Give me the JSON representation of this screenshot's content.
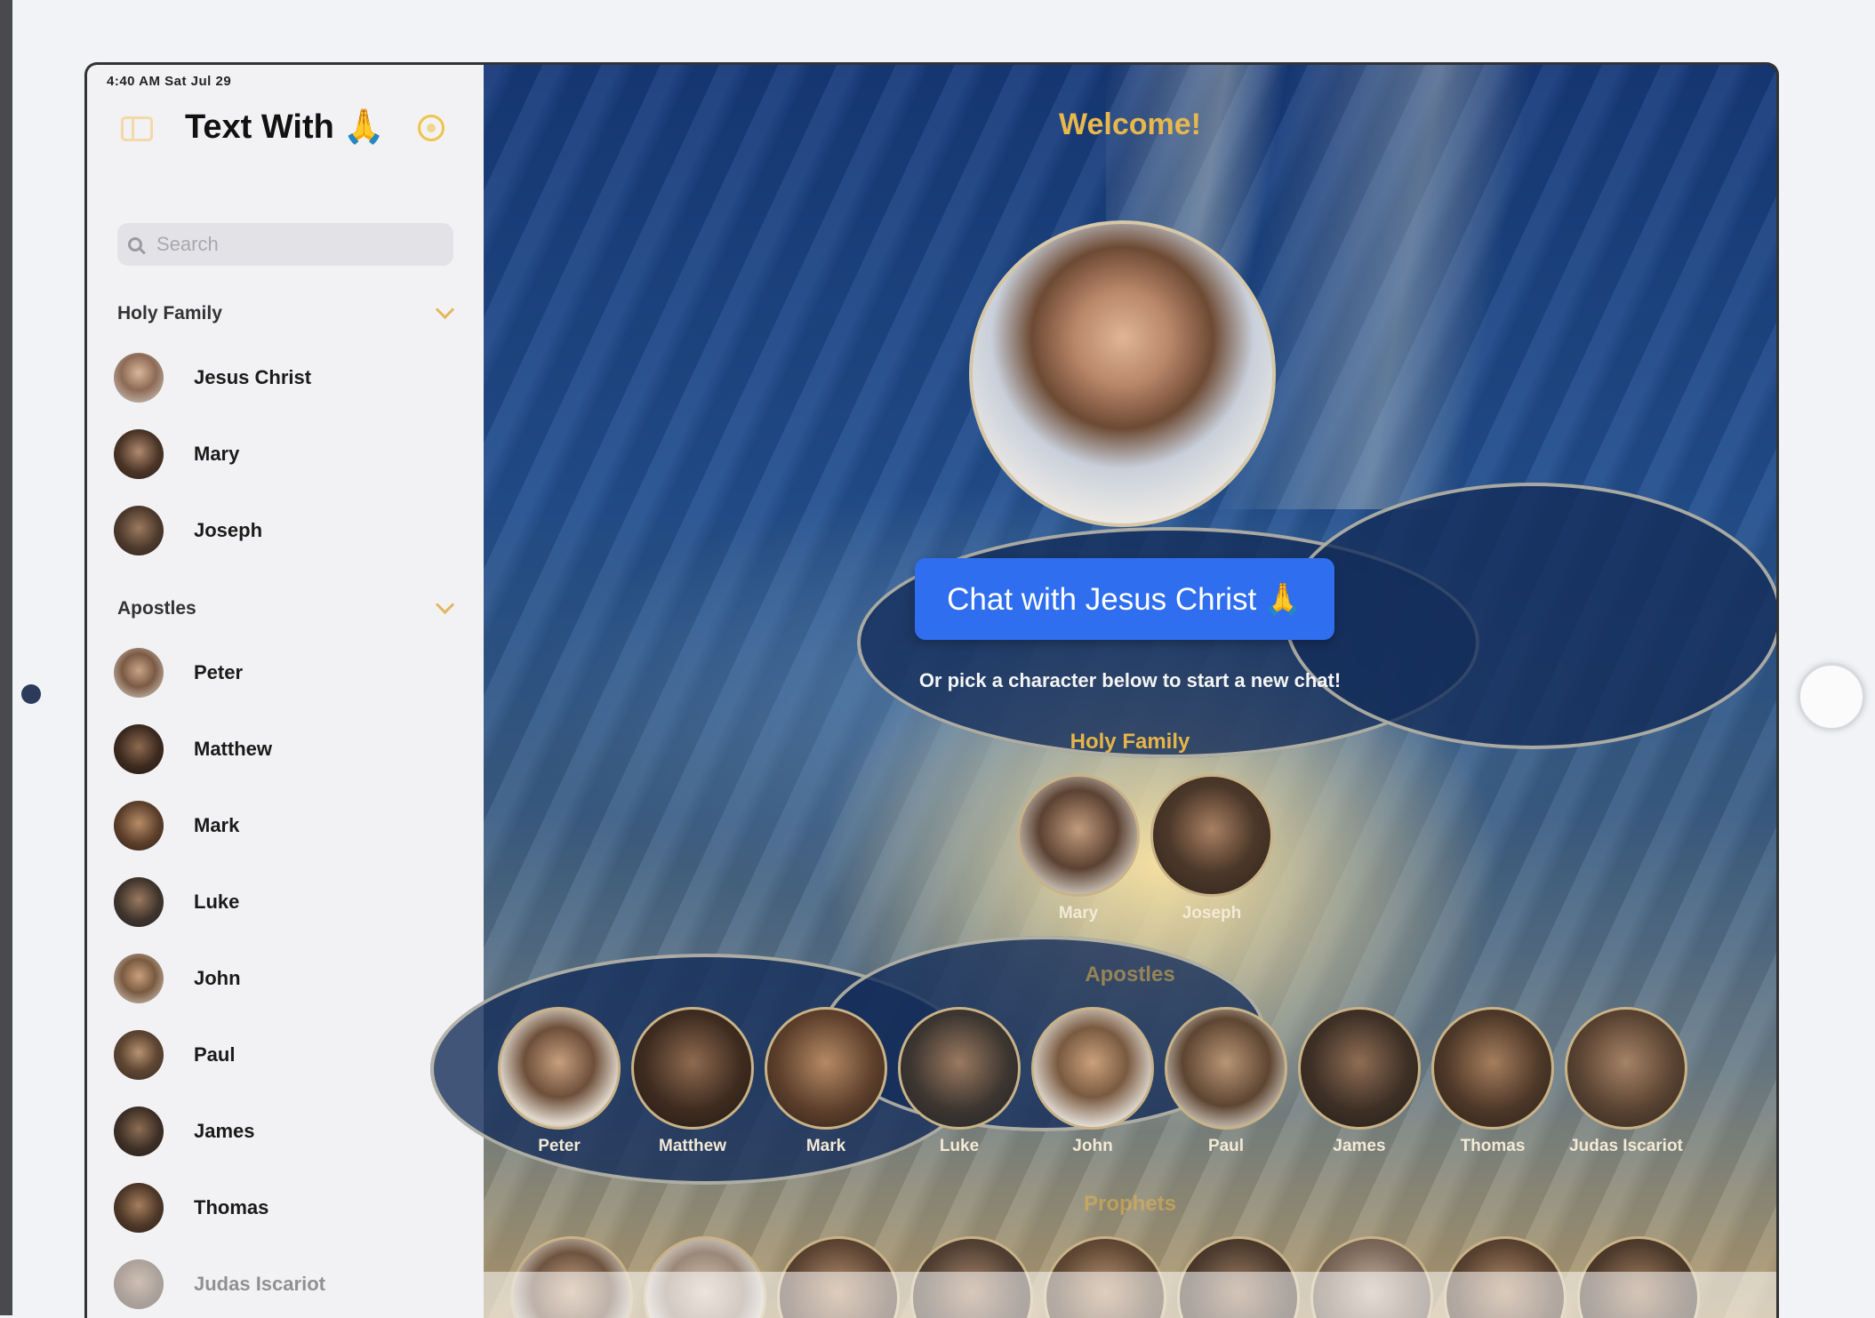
{
  "status_bar": {
    "time": "4:40 AM  Sat Jul 29"
  },
  "sidebar": {
    "title": "Text With",
    "title_icon": "🙏",
    "search_placeholder": "Search",
    "sections": [
      {
        "name": "Holy Family",
        "items": [
          "Jesus Christ",
          "Mary",
          "Joseph"
        ]
      },
      {
        "name": "Apostles",
        "items": [
          "Peter",
          "Matthew",
          "Mark",
          "Luke",
          "John",
          "Paul",
          "James",
          "Thomas",
          "Judas Iscariot"
        ]
      }
    ]
  },
  "main": {
    "welcome": "Welcome!",
    "hero_name": "Jesus Christ",
    "chat_button_label": "Chat with Jesus Christ",
    "chat_button_icon": "🙏",
    "pick_text": "Or pick a character below to start a new chat!",
    "holy_family_header": "Holy Family",
    "holy_family": [
      "Mary",
      "Joseph"
    ],
    "apostles_header": "Apostles",
    "apostles": [
      "Peter",
      "Matthew",
      "Mark",
      "Luke",
      "John",
      "Paul",
      "James",
      "Thomas",
      "Judas Iscariot"
    ],
    "prophets_header": "Prophets"
  },
  "colors": {
    "accent": "#e8b84c",
    "button": "#2f6fef",
    "sidebar_bg": "#f2f2f4"
  }
}
